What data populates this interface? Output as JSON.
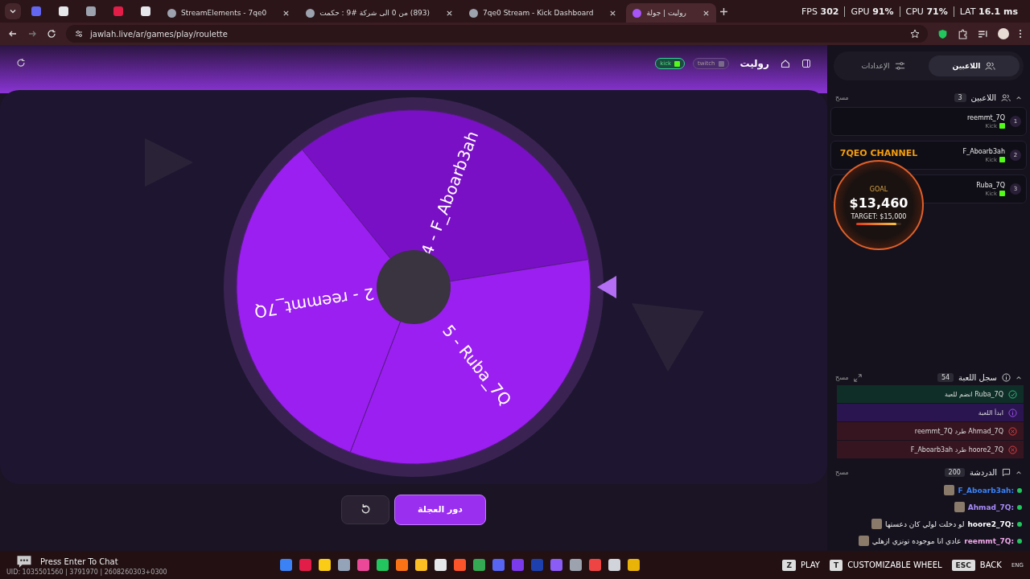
{
  "browser": {
    "tabs": [
      {
        "title": "روليت | جولة",
        "selected": true
      },
      {
        "title": "7qe0 Stream - Kick Dashboard",
        "selected": false
      },
      {
        "title": "(893) من 0 الى شركة #9 : حكمت",
        "selected": false
      },
      {
        "title": "StreamElements - 7qe0",
        "selected": false
      }
    ],
    "url": "jawlah.live/ar/games/play/roulette",
    "stats": [
      "LAT **16.1 ms**",
      "CPU **71%**",
      "GPU **91%**",
      "FPS **302**"
    ]
  },
  "header": {
    "title": "روليت",
    "platforms": [
      {
        "label": "twitch",
        "active": false
      },
      {
        "label": "kick",
        "active": true
      }
    ]
  },
  "wheel": {
    "segments": [
      {
        "label": "4 - F_Aboarb3ah",
        "color": "#7a10c6"
      },
      {
        "label": "5 - Ruba_7Q",
        "color": "#9a1ff0"
      },
      {
        "label": "2 - reemmt_7Q",
        "color": "#9a1ff0"
      }
    ]
  },
  "controls": {
    "spin": "دور العجلة"
  },
  "panel": {
    "tabs": [
      {
        "label": "اللاعبين",
        "selected": true
      },
      {
        "label": "الإعدادات",
        "selected": false
      }
    ],
    "players": {
      "title": "اللاعبين",
      "count": "3",
      "clear": "مسح",
      "items": [
        {
          "rank": "1",
          "name": "reemmt_7Q",
          "platform": "Kick"
        },
        {
          "rank": "2",
          "name": "F_Aboarb3ah",
          "platform": "Kick"
        },
        {
          "rank": "3",
          "name": "Ruba_7Q",
          "platform": "Kick"
        }
      ]
    },
    "log": {
      "title": "سجل اللعبة",
      "count": "54",
      "clear": "مسح",
      "entries": [
        {
          "kind": "join",
          "text": "Ruba_7Q انضم للعبة"
        },
        {
          "kind": "start",
          "text": "ابدأ اللعبة"
        },
        {
          "kind": "kick",
          "text": "Ahmad_7Q طرد reemmt_7Q"
        },
        {
          "kind": "kick",
          "text": "hoore2_7Q طرد F_Aboarb3ah"
        }
      ]
    },
    "chat": {
      "title": "الدردشة",
      "count": "200",
      "clear": "مسح",
      "messages": [
        {
          "user": "F_Aboarb3ah:",
          "color": "#3b82f6"
        },
        {
          "user": "Ahmad_7Q:",
          "color": "#a78bfa"
        },
        {
          "user": "hoore2_7Q:",
          "text": "لو دخلت لولي كان دعستها",
          "color": "#ffffff"
        },
        {
          "user": "reemmt_7Q:",
          "text": "عادي انا موجوده تونزي ازهلي",
          "color": "#f0a8e8"
        }
      ]
    }
  },
  "overlay": {
    "channel": "7QEO CHANNEL",
    "goal_label": "GOAL",
    "amount": "$13,460",
    "target": "TARGET: $15,000",
    "level": 0.9
  },
  "stream_bar": {
    "chat_hint": "Press Enter To Chat",
    "uid": "UID: 1035501560 | 3791970 | 2608260303+0300",
    "language": "ENG",
    "keys": [
      {
        "key": "ESC",
        "action": "BACK"
      },
      {
        "key": "T",
        "action": "CUSTOMIZABLE WHEEL"
      },
      {
        "key": "Z",
        "action": "PLAY"
      }
    ]
  }
}
